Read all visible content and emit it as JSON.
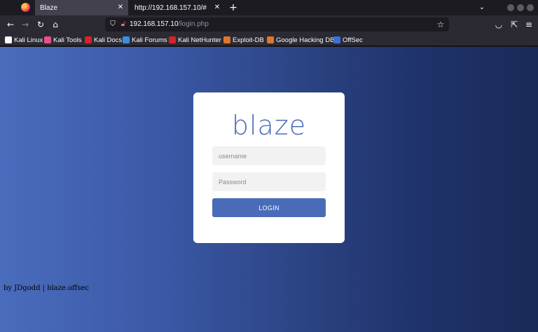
{
  "browser": {
    "tabs": [
      {
        "title": "Blaze",
        "close": "✕"
      },
      {
        "title": "http://192.168.157.10/#",
        "close": "✕"
      }
    ],
    "new_tab": "+",
    "tab_list": "⌄",
    "nav": {
      "back": "←",
      "forward": "→",
      "reload": "↻",
      "home": "⌂"
    },
    "url": {
      "host": "192.168.157.10",
      "path": "/login.php"
    },
    "toolbar": {
      "pocket": "◡",
      "extensions": "⇱",
      "menu": "≡",
      "star": "☆"
    },
    "bookmarks": [
      {
        "label": "Kali Linux",
        "color": "#ffffff"
      },
      {
        "label": "Kali Tools",
        "color": "#e8508b"
      },
      {
        "label": "Kali Docs",
        "color": "#d6222e"
      },
      {
        "label": "Kali Forums",
        "color": "#3c8fe0"
      },
      {
        "label": "Kali NetHunter",
        "color": "#d6222e"
      },
      {
        "label": "Exploit-DB",
        "color": "#e0762b"
      },
      {
        "label": "Google Hacking DB",
        "color": "#e0762b"
      },
      {
        "label": "OffSec",
        "color": "#3c6fe0"
      }
    ]
  },
  "login": {
    "logo": "blaze",
    "username_placeholder": "username",
    "password_placeholder": "Password",
    "button": "LOGIN"
  },
  "footer": "by JDgodd | blaze.offsec",
  "colors": {
    "accent": "#4a6cb8"
  }
}
